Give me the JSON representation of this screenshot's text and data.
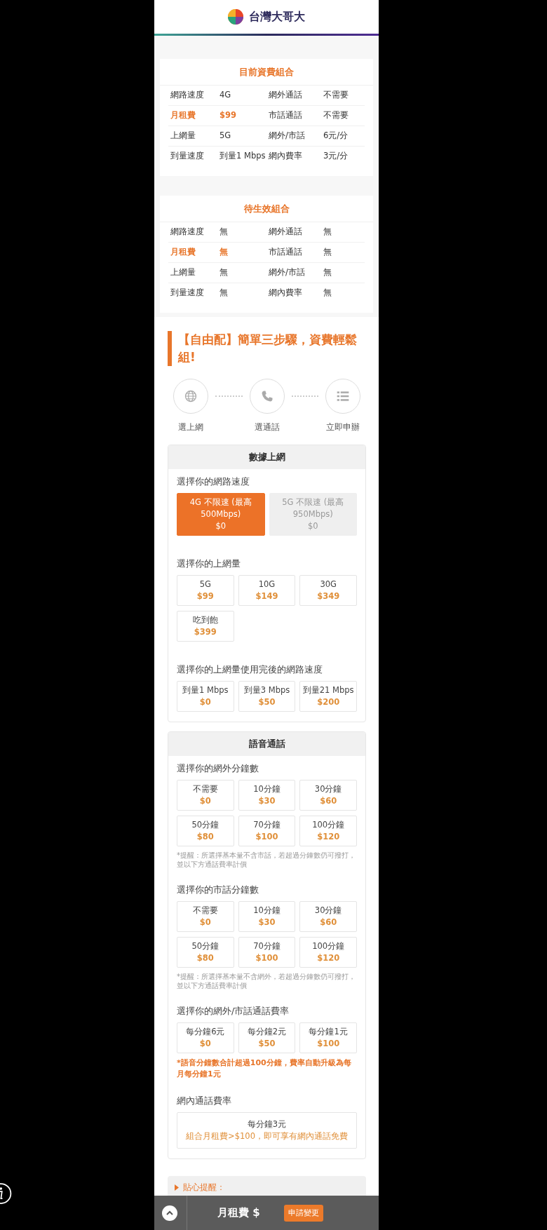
{
  "header": {
    "brand": "台灣大哥大"
  },
  "current_plan": {
    "title": "目前資費組合",
    "rows": [
      {
        "highlighted": false,
        "cells": [
          "網路速度",
          "4G",
          "網外通話",
          "不需要"
        ]
      },
      {
        "highlighted": true,
        "cells": [
          "月租費",
          "$99",
          "市話通話",
          "不需要"
        ]
      },
      {
        "highlighted": false,
        "cells": [
          "上網量",
          "5G",
          "網外/市話",
          "6元/分"
        ]
      },
      {
        "highlighted": false,
        "cells": [
          "到量速度",
          "到量1 Mbps",
          "網內費率",
          "3元/分"
        ]
      }
    ]
  },
  "pending_plan": {
    "title": "待生效組合",
    "rows": [
      {
        "highlighted": false,
        "cells": [
          "網路速度",
          "無",
          "網外通話",
          "無"
        ]
      },
      {
        "highlighted": true,
        "cells": [
          "月租費",
          "無",
          "市話通話",
          "無"
        ]
      },
      {
        "highlighted": false,
        "cells": [
          "上網量",
          "無",
          "網外/市話",
          "無"
        ]
      },
      {
        "highlighted": false,
        "cells": [
          "到量速度",
          "無",
          "網內費率",
          "無"
        ]
      }
    ]
  },
  "builder": {
    "title": "【自由配】簡單三步驟，資費輕鬆組!",
    "steps": [
      {
        "kind": "globe",
        "label": "選上網"
      },
      {
        "kind": "phone",
        "label": "選通話"
      },
      {
        "kind": "list",
        "label": "立即申辦"
      }
    ]
  },
  "sections": [
    {
      "title": "數據上網",
      "groups": [
        {
          "label": "選擇你的網路速度",
          "kind": "pair",
          "options": [
            {
              "name": "4G 不限速 (最高 500Mbps)",
              "price": "$0",
              "selected": true,
              "disabled": false
            },
            {
              "name": "5G 不限速 (最高 950Mbps)",
              "price": "$0",
              "selected": false,
              "disabled": true
            }
          ]
        },
        {
          "label": "選擇你的上網量",
          "kind": "grid",
          "options": [
            {
              "name": "5G",
              "price": "$99",
              "selected": false,
              "disabled": false
            },
            {
              "name": "10G",
              "price": "$149",
              "selected": false,
              "disabled": false
            },
            {
              "name": "30G",
              "price": "$349",
              "selected": false,
              "disabled": false
            },
            {
              "name": "吃到飽",
              "price": "$399",
              "selected": false,
              "disabled": false
            }
          ]
        },
        {
          "label": "選擇你的上網量使用完後的網路速度",
          "kind": "grid",
          "options": [
            {
              "name": "到量1 Mbps",
              "price": "$0",
              "selected": false,
              "disabled": false
            },
            {
              "name": "到量3 Mbps",
              "price": "$50",
              "selected": false,
              "disabled": false
            },
            {
              "name": "到量21 Mbps",
              "price": "$200",
              "selected": false,
              "disabled": false
            }
          ]
        }
      ]
    },
    {
      "title": "語音通話",
      "groups": [
        {
          "label": "選擇你的網外分鐘數",
          "kind": "grid",
          "options": [
            {
              "name": "不需要",
              "price": "$0",
              "selected": false,
              "disabled": false
            },
            {
              "name": "10分鐘",
              "price": "$30",
              "selected": false,
              "disabled": false
            },
            {
              "name": "30分鐘",
              "price": "$60",
              "selected": false,
              "disabled": false
            },
            {
              "name": "50分鐘",
              "price": "$80",
              "selected": false,
              "disabled": false
            },
            {
              "name": "70分鐘",
              "price": "$100",
              "selected": false,
              "disabled": false
            },
            {
              "name": "100分鐘",
              "price": "$120",
              "selected": false,
              "disabled": false
            }
          ],
          "note": {
            "kind": "hint",
            "text": "*提醒：所選擇基本量不含市話，若超過分鐘數仍可撥打，並以下方通話費率計價"
          }
        },
        {
          "label": "選擇你的市話分鐘數",
          "kind": "grid",
          "options": [
            {
              "name": "不需要",
              "price": "$0",
              "selected": false,
              "disabled": false
            },
            {
              "name": "10分鐘",
              "price": "$30",
              "selected": false,
              "disabled": false
            },
            {
              "name": "30分鐘",
              "price": "$60",
              "selected": false,
              "disabled": false
            },
            {
              "name": "50分鐘",
              "price": "$80",
              "selected": false,
              "disabled": false
            },
            {
              "name": "70分鐘",
              "price": "$100",
              "selected": false,
              "disabled": false
            },
            {
              "name": "100分鐘",
              "price": "$120",
              "selected": false,
              "disabled": false
            }
          ],
          "note": {
            "kind": "hint",
            "text": "*提醒：所選擇基本量不含網外，若超過分鐘數仍可撥打，並以下方通話費率計價"
          }
        },
        {
          "label": "選擇你的網外/市話通話費率",
          "kind": "grid",
          "options": [
            {
              "name": "每分鐘6元",
              "price": "$0",
              "selected": false,
              "disabled": false
            },
            {
              "name": "每分鐘2元",
              "price": "$50",
              "selected": false,
              "disabled": false
            },
            {
              "name": "每分鐘1元",
              "price": "$100",
              "selected": false,
              "disabled": false
            }
          ],
          "note": {
            "kind": "warning",
            "text": "*語音分鐘數合計超過100分鐘，費率自動升級為每月每分鐘1元"
          }
        },
        {
          "label": "網內通話費率",
          "kind": "rate",
          "info": {
            "name": "每分鐘3元",
            "price": "組合月租費>$100，即可享有網內通話免費"
          }
        }
      ]
    }
  ],
  "tips": {
    "label": "貼心提醒："
  },
  "bottom_bar": {
    "label": "月租費 $",
    "button": "申請變更"
  }
}
